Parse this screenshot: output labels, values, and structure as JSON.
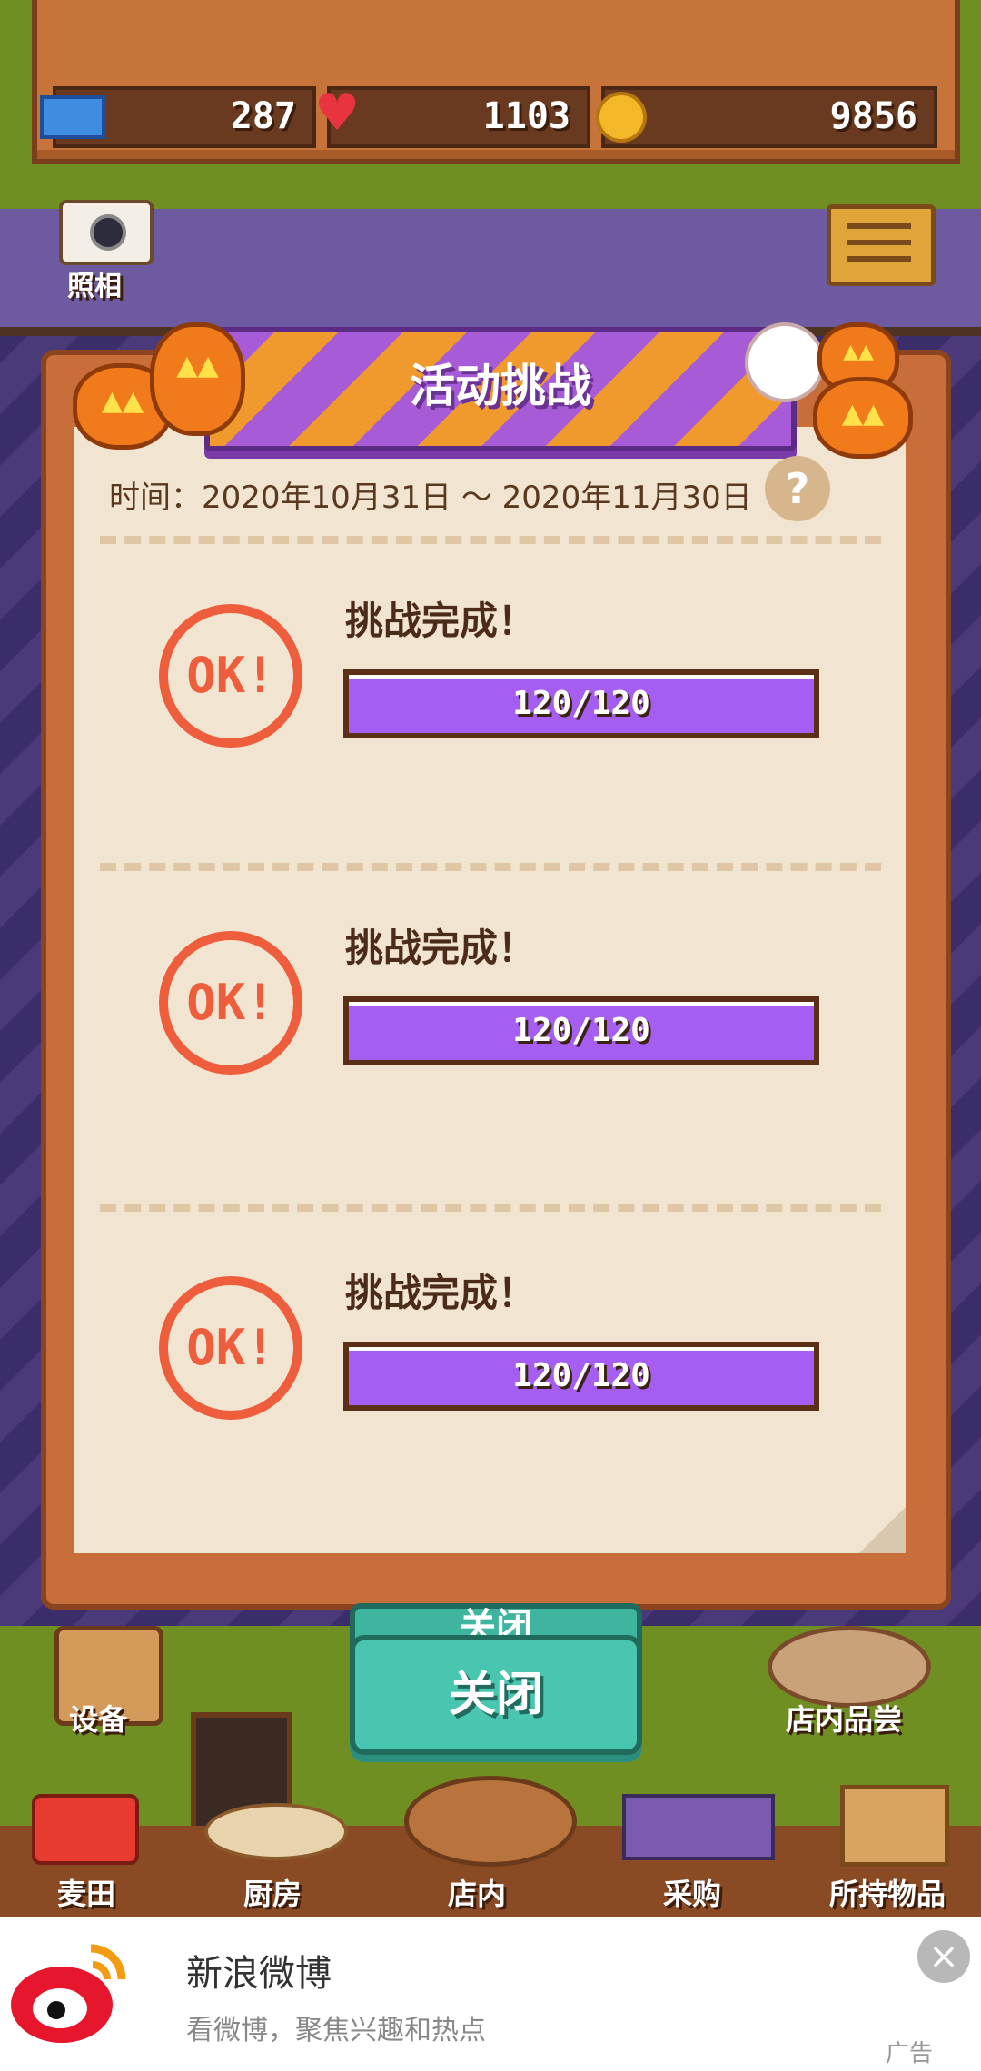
{
  "stats": {
    "tickets": "287",
    "hearts": "1103",
    "coins": "9856"
  },
  "photo_label": "照相",
  "dialog": {
    "title": "活动挑战",
    "time": "时间：2020年10月31日 ～ 2020年11月30日",
    "help": "?"
  },
  "challenges": [
    {
      "stamp": "OK!",
      "label": "挑战完成！",
      "progress": "120/120",
      "fraction": 1.0
    },
    {
      "stamp": "OK!",
      "label": "挑战完成！",
      "progress": "120/120",
      "fraction": 1.0
    },
    {
      "stamp": "OK!",
      "label": "挑战完成！",
      "progress": "120/120",
      "fraction": 1.0
    }
  ],
  "close_button": "关闭",
  "close_button_back": "关闭",
  "side": {
    "equipment": "设备",
    "tasting": "店内品尝"
  },
  "nav": [
    "麦田",
    "厨房",
    "店内",
    "采购",
    "所持物品"
  ],
  "ad": {
    "title": "新浪微博",
    "subtitle": "看微博，聚焦兴趣和热点",
    "tag": "广告",
    "close": "×"
  },
  "colors": {
    "accent_purple": "#a65df1",
    "stamp_red": "#ee5d3c",
    "button_teal": "#48c6b0"
  }
}
